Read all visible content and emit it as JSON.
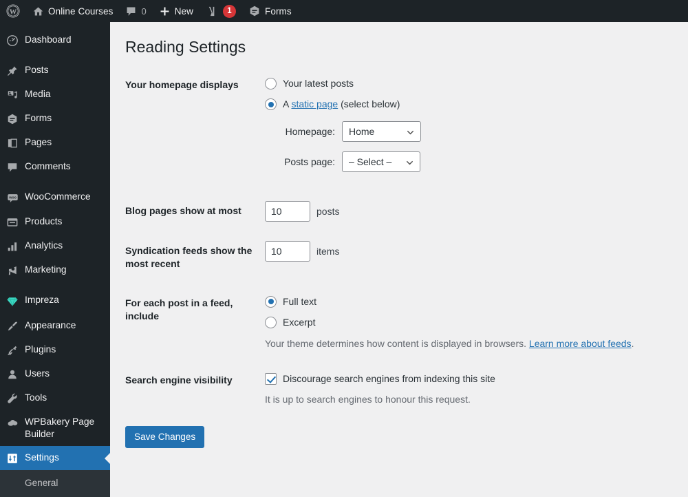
{
  "adminbar": {
    "wp_logo_icon": "wordpress-logo-icon",
    "site_name": "Online Courses",
    "site_icon": "home-icon",
    "comments_icon": "comment-bubble-icon",
    "comments_count": "0",
    "new_icon": "plus-icon",
    "new_label": "New",
    "yoast_icon": "yoast-logo-icon",
    "yoast_badge": "1",
    "forms_icon": "gravity-forms-icon",
    "forms_label": "Forms"
  },
  "sidebar": {
    "items": [
      {
        "label": "Dashboard",
        "icon": "dashboard-icon",
        "current": false,
        "sep_after": true
      },
      {
        "label": "Posts",
        "icon": "pin-icon",
        "current": false,
        "sep_after": false
      },
      {
        "label": "Media",
        "icon": "media-icon",
        "current": false,
        "sep_after": false
      },
      {
        "label": "Forms",
        "icon": "gravity-forms-icon",
        "current": false,
        "sep_after": false
      },
      {
        "label": "Pages",
        "icon": "pages-icon",
        "current": false,
        "sep_after": false
      },
      {
        "label": "Comments",
        "icon": "comment-bubble-icon",
        "current": false,
        "sep_after": true
      },
      {
        "label": "WooCommerce",
        "icon": "woocommerce-icon",
        "current": false,
        "sep_after": false
      },
      {
        "label": "Products",
        "icon": "products-icon",
        "current": false,
        "sep_after": false
      },
      {
        "label": "Analytics",
        "icon": "analytics-bars-icon",
        "current": false,
        "sep_after": false
      },
      {
        "label": "Marketing",
        "icon": "megaphone-icon",
        "current": false,
        "sep_after": true
      },
      {
        "label": "Impreza",
        "icon": "diamond-icon",
        "current": false,
        "sep_after": false
      },
      {
        "label": "Appearance",
        "icon": "paintbrush-icon",
        "current": false,
        "sep_after": false
      },
      {
        "label": "Plugins",
        "icon": "plug-icon",
        "current": false,
        "sep_after": false
      },
      {
        "label": "Users",
        "icon": "user-icon",
        "current": false,
        "sep_after": false
      },
      {
        "label": "Tools",
        "icon": "wrench-icon",
        "current": false,
        "sep_after": false
      },
      {
        "label": "WPBakery Page Builder",
        "icon": "cloud-icon",
        "current": false,
        "sep_after": false
      },
      {
        "label": "Settings",
        "icon": "settings-sliders-icon",
        "current": true,
        "sep_after": false
      }
    ],
    "submenu": [
      {
        "label": "General"
      }
    ],
    "accent_current": "#2271b1"
  },
  "main": {
    "page_title": "Reading Settings",
    "rows": {
      "homepage_displays": {
        "label": "Your homepage displays",
        "option_latest": "Your latest posts",
        "option_latest_checked": false,
        "option_static_prefix": "A ",
        "option_static_link": "static page",
        "option_static_suffix": " (select below)",
        "option_static_checked": true,
        "homepage_label": "Homepage:",
        "homepage_value": "Home",
        "posts_page_label": "Posts page:",
        "posts_page_value": "– Select –",
        "chevron_icon": "chevron-down-icon"
      },
      "blog_pages": {
        "label": "Blog pages show at most",
        "value": "10",
        "unit": "posts"
      },
      "syndication": {
        "label": "Syndication feeds show the most recent",
        "value": "10",
        "unit": "items"
      },
      "feed_include": {
        "label": "For each post in a feed, include",
        "option_full": "Full text",
        "option_full_checked": true,
        "option_excerpt": "Excerpt",
        "option_excerpt_checked": false,
        "description_prefix": "Your theme determines how content is displayed in browsers. ",
        "description_link": "Learn more about feeds",
        "description_suffix": "."
      },
      "search_visibility": {
        "label": "Search engine visibility",
        "checkbox_label": "Discourage search engines from indexing this site",
        "checkbox_checked": true,
        "description": "It is up to search engines to honour this request."
      }
    },
    "submit_label": "Save Changes",
    "primary_color": "#2271b1"
  }
}
